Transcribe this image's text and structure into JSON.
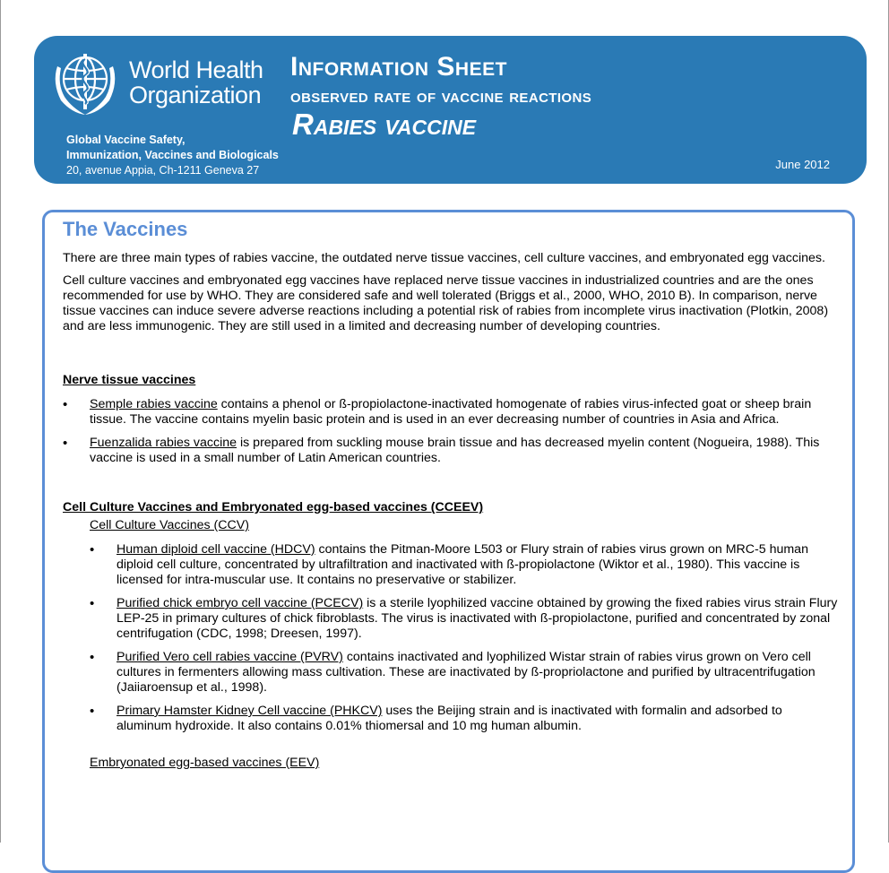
{
  "header": {
    "org_line1": "World Health",
    "org_line2": "Organization",
    "dept_line1": "Global Vaccine Safety,",
    "dept_line2": "Immunization, Vaccines and Biologicals",
    "address": "20, avenue Appia, Ch-1211 Geneva 27",
    "title": "Information Sheet",
    "subtitle": "observed rate of vaccine reactions",
    "vaccine": "Rabies vaccine",
    "date": "June 2012",
    "banner_color": "#2a7ab5"
  },
  "section": {
    "heading": "The Vaccines",
    "heading_color": "#5b8ed6",
    "intro1": "There are three main types of rabies vaccine, the outdated nerve tissue vaccines, cell culture vaccines, and embryonated egg vaccines.",
    "intro2": "Cell culture vaccines and embryonated egg vaccines have replaced nerve tissue vaccines in industrialized countries and are the ones recommended for use by WHO. They are considered safe and well tolerated (Briggs et al., 2000, WHO, 2010 B). In comparison, nerve tissue vaccines can induce severe adverse reactions including a potential risk of rabies from incomplete virus inactivation (Plotkin, 2008) and are less immunogenic. They are still used in a limited and decreasing number of developing countries."
  },
  "nerve": {
    "heading": "Nerve tissue vaccines",
    "items": [
      {
        "term": "Semple rabies vaccine",
        "text": " contains a phenol or ß-propiolactone-inactivated homogenate of rabies virus-infected goat or sheep brain tissue. The vaccine contains myelin basic protein and is used in an ever decreasing number of countries in Asia and Africa."
      },
      {
        "term": "Fuenzalida rabies vaccine",
        "text": " is prepared from suckling mouse brain tissue and has decreased myelin content (Nogueira, 1988). This vaccine is used in a small number of Latin American countries."
      }
    ]
  },
  "cceev": {
    "heading": "Cell Culture Vaccines and Embryonated egg-based vaccines (CCEEV)",
    "ccv_heading": "Cell Culture Vaccines (CCV)",
    "items": [
      {
        "term": "Human diploid cell vaccine (HDCV)",
        "text": " contains the Pitman-Moore L503 or Flury strain of rabies virus grown on MRC-5 human diploid cell culture, concentrated by ultrafiltration and inactivated with ß-propiolactone (Wiktor et al., 1980). This vaccine is licensed for intra-muscular use. It contains no preservative or stabilizer."
      },
      {
        "term": "Purified chick embryo cell vaccine (PCECV)",
        "text": " is a sterile lyophilized vaccine obtained by growing the fixed rabies virus strain Flury LEP-25 in primary cultures of chick fibroblasts. The virus is inactivated with ß-propiolactone, purified and concentrated by zonal centrifugation (CDC, 1998; Dreesen, 1997)."
      },
      {
        "term": "Purified Vero cell rabies vaccine (PVRV)",
        "text": " contains inactivated and lyophilized Wistar strain of rabies virus grown on Vero cell cultures in fermenters allowing mass cultivation. These are inactivated by ß-propriolactone and purified by ultracentrifugation (Jaiiaroensup et al., 1998)."
      },
      {
        "term": "Primary Hamster Kidney Cell vaccine (PHKCV)",
        "text": " uses the Beijing strain and is inactivated with formalin and adsorbed to aluminum hydroxide. It also contains 0.01% thiomersal and 10 mg human albumin."
      }
    ],
    "eev_heading": "Embryonated egg-based vaccines (EEV)"
  },
  "icons": {
    "bullet": "•",
    "emblem": "who-emblem-icon"
  }
}
